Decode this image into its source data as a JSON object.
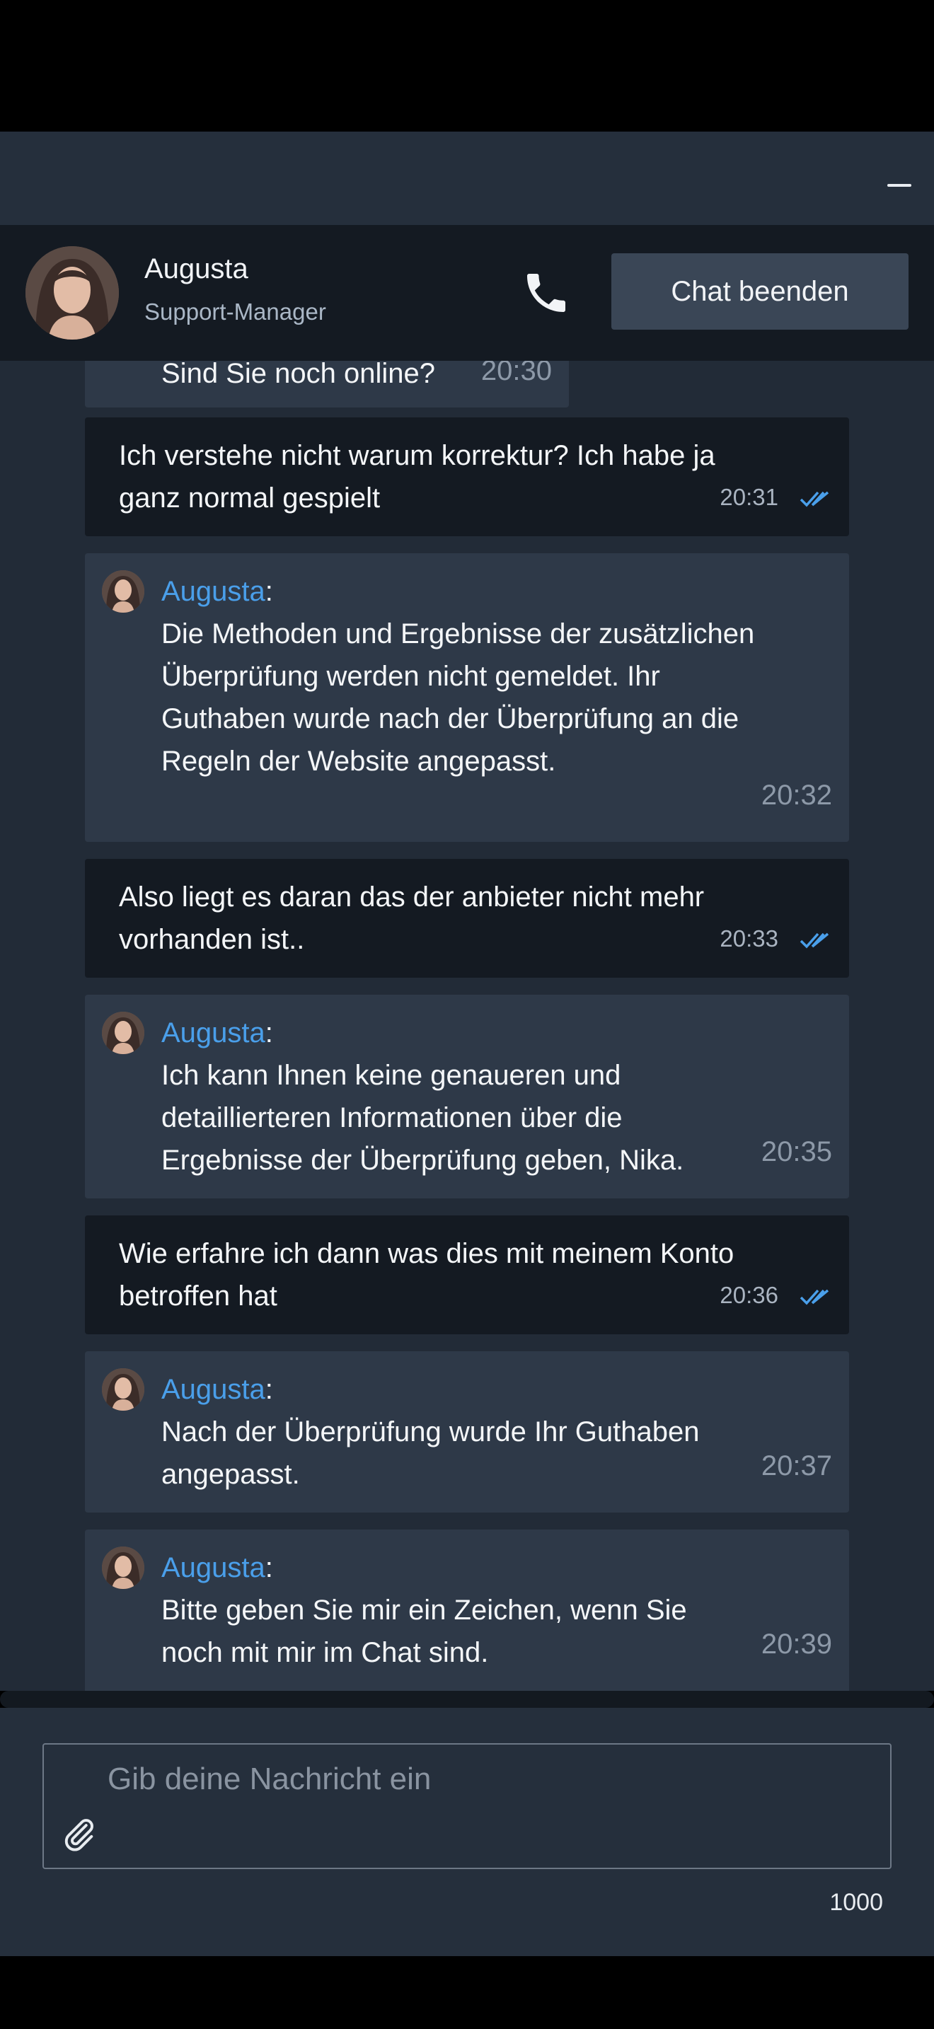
{
  "window": {
    "minimize_icon": "minimize-icon"
  },
  "header": {
    "agent_name": "Augusta",
    "agent_role": "Support-Manager",
    "end_chat_label": "Chat beenden",
    "phone_icon": "phone-icon"
  },
  "messages": [
    {
      "from": "agent-partial",
      "text": "Sind Sie noch online?",
      "time": "20:30"
    },
    {
      "from": "user",
      "text": "Ich verstehe nicht warum korrektur? Ich habe ja ganz normal gespielt",
      "time": "20:31"
    },
    {
      "from": "agent",
      "name": "Augusta",
      "text": "Die Methoden und Ergebnisse der zusätzlichen Überprüfung werden nicht gemeldet. Ihr Guthaben wurde nach der Überprüfung an die Regeln der Website angepasst.",
      "time": "20:32"
    },
    {
      "from": "user",
      "text": "Also liegt es daran das der anbieter nicht mehr vorhanden ist..",
      "time": "20:33"
    },
    {
      "from": "agent",
      "name": "Augusta",
      "text": "Ich kann Ihnen keine genaueren und detaillierteren Informationen über die Ergebnisse der Überprüfung geben, Nika.",
      "time": "20:35"
    },
    {
      "from": "user",
      "text": "Wie erfahre ich dann was dies mit meinem Konto betroffen hat",
      "time": "20:36"
    },
    {
      "from": "agent",
      "name": "Augusta",
      "text": "Nach der Überprüfung wurde Ihr Guthaben angepasst.",
      "time": "20:37"
    },
    {
      "from": "agent",
      "name": "Augusta",
      "text": "Bitte geben Sie mir ein Zeichen, wenn Sie noch mit mir im Chat sind.",
      "time": "20:39"
    }
  ],
  "composer": {
    "placeholder": "Gib deine Nachricht ein",
    "value": "",
    "char_counter": "1000",
    "attach_icon": "paperclip-icon"
  },
  "colors": {
    "accent_name": "#4a9fea",
    "read_ticks": "#4a9fea",
    "user_bubble": "#141a22",
    "agent_bubble": "#2e3948",
    "background": "#222b37"
  }
}
